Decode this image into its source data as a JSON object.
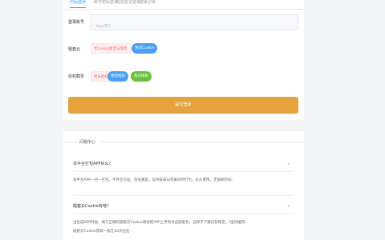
{
  "tabs": [
    "扫码登录",
    "账号密码登录",
    "短信验证登录",
    "登录记录"
  ],
  "login_form": {
    "account_label": "登录账号",
    "account_placeholder": "bay001",
    "cloud_label": "题套云",
    "cloud_status": "无cookie暂无法使用",
    "cloud_button": "更新Cookie",
    "auth_label": "授权截至",
    "auth_status": "暂未授权",
    "renew_button": "更新授权",
    "buy_button": "购买授权",
    "submit_label": "提交登录"
  },
  "faq": {
    "title": "问题中心",
    "items": [
      {
        "question": "本平台打包APP好么?",
        "answer_lines": [
          "本平台APP一对一打包，不存在包名，签名重复，支持安卓与苹果同时打包，永久使用，无限期时间。"
        ]
      },
      {
        "question": "题套云Cookie有啥?",
        "answer_lines": [
          "当生成APP时候，填写正确的题套云Cookie来会把APP上传到对应题套云，这样子下载比较稳定。(强烈推荐)",
          "题套云Cookie获取一般在20天左右"
        ]
      }
    ]
  },
  "colors": {
    "accent": "#409eff",
    "submit": "#e6a23c",
    "green": "#67c23a",
    "danger": "#f56c6c"
  }
}
